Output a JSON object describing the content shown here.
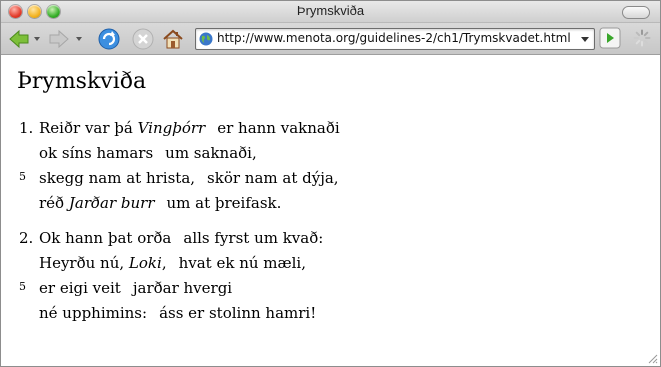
{
  "window": {
    "title": "Þrymskviða"
  },
  "toolbar": {
    "url": "http://www.menota.org/guidelines-2/ch1/Trymskvadet.html",
    "icons": {
      "back": "back-arrow-icon",
      "forward": "forward-arrow-icon",
      "reload": "reload-icon",
      "stop": "stop-icon",
      "home": "home-icon",
      "site": "globe-icon",
      "go": "go-icon",
      "activity": "spinner-icon"
    }
  },
  "page": {
    "title": "Þrymskviða",
    "stanzas": [
      {
        "number": "1.",
        "lines": [
          {
            "a1": "Reiðr var þá ",
            "a_em": "Vingþórr",
            "a2": "",
            "b1": "er hann vaknaði",
            "b_em": "",
            "b2": "",
            "num": ""
          },
          {
            "a1": "ok síns hamars",
            "a_em": "",
            "a2": "",
            "b1": "um saknaði,",
            "b_em": "",
            "b2": "",
            "num": ""
          },
          {
            "a1": "skegg nam at hrista,",
            "a_em": "",
            "a2": "",
            "b1": "skör nam at dýja,",
            "b_em": "",
            "b2": "",
            "num": "5"
          },
          {
            "a1": "réð ",
            "a_em": "Jarðar burr",
            "a2": "",
            "b1": "um at þreifask.",
            "b_em": "",
            "b2": "",
            "num": ""
          }
        ]
      },
      {
        "number": "2.",
        "lines": [
          {
            "a1": "Ok hann þat orða",
            "a_em": "",
            "a2": "",
            "b1": "alls fyrst um kvað:",
            "b_em": "",
            "b2": "",
            "num": ""
          },
          {
            "a1": "Heyrðu nú, ",
            "a_em": "Loki",
            "a2": ",",
            "b1": "hvat ek nú mæli,",
            "b_em": "",
            "b2": "",
            "num": ""
          },
          {
            "a1": "er eigi veit",
            "a_em": "",
            "a2": "",
            "b1": "jarðar hvergi",
            "b_em": "",
            "b2": "",
            "num": "5"
          },
          {
            "a1": "né upphimins:",
            "a_em": "",
            "a2": "",
            "b1": "áss er stolinn hamri!",
            "b_em": "",
            "b2": "",
            "num": ""
          }
        ]
      }
    ]
  }
}
